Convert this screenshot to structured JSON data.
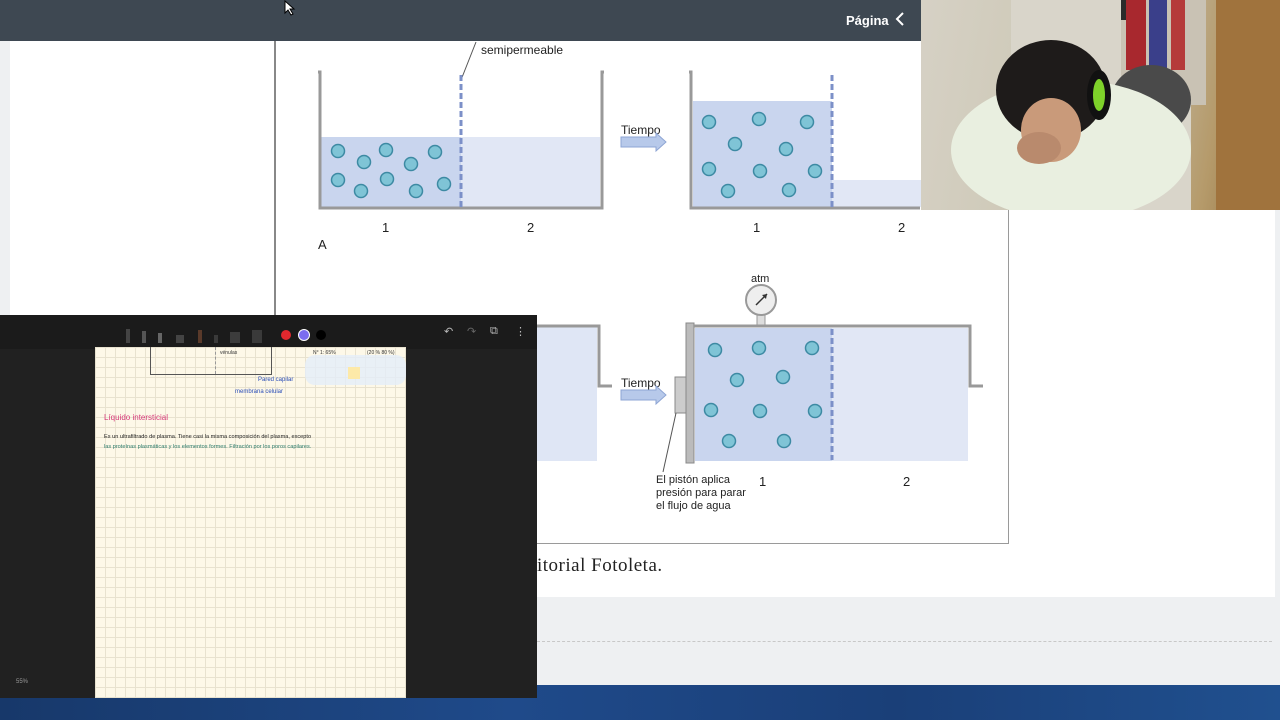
{
  "topbar": {
    "page_label": "Página",
    "back_icon": "chevron-left-icon"
  },
  "figure": {
    "label_semipermeable": "semipermeable",
    "label_tiempo_top": "Tiempo",
    "label_tiempo_bottom": "Tiempo",
    "top_left_labels": [
      "1",
      "2"
    ],
    "top_right_labels": [
      "1",
      "2"
    ],
    "panel_letter": "A",
    "atm_label": "atm",
    "piston_caption": [
      "El pistón aplica",
      "presión para parar",
      "el flujo de agua"
    ],
    "bottom_labels": [
      "1",
      "2"
    ]
  },
  "caption_text": "itorial Fotoleta.",
  "notes_app": {
    "zoom": "55%",
    "toolbar_icons": [
      "undo-icon",
      "redo-icon",
      "external-open-icon",
      "more-vertical-icon"
    ],
    "colors": {
      "red": "#e0282e",
      "purple": "#7b6cf0"
    },
    "note_lines": {
      "top_label_a": "vénulas",
      "top_label_b": "N° 1: 65%",
      "top_label_c": "(20 %  80 %)",
      "arrow_label_1": "Pared capilar",
      "arrow_label_2": "membrana celular",
      "heading": "Líquido intersticial",
      "line_1": "Es un ultrafiltrado de plasma. Tiene casi la misma composición del plasma, excepto",
      "line_2": "las proteínas plasmáticas y los elementos formes. Filtración por los poros capilares."
    }
  }
}
